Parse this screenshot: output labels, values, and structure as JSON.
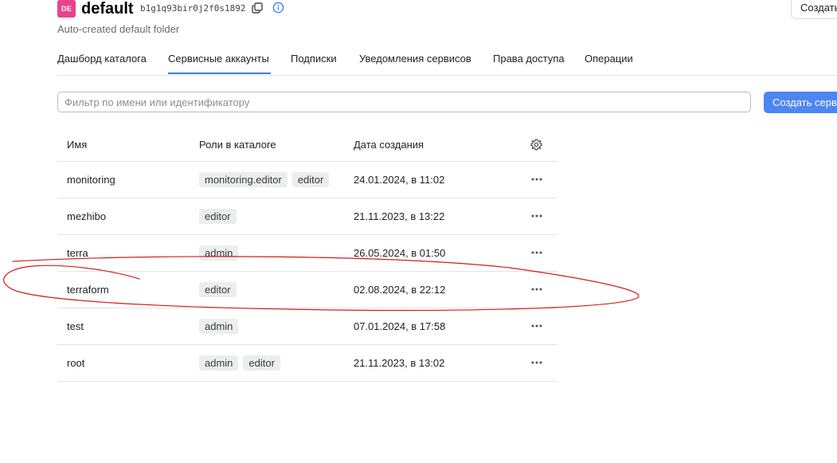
{
  "colors": {
    "accent_pink": "#e8428b",
    "accent_blue": "#3b7be8",
    "annotation_red": "#d21c1c"
  },
  "header": {
    "badge": "DE",
    "folder_name": "default",
    "folder_id": "b1g1q93bir0j2f0s1892",
    "copy_icon": "copy-icon",
    "info_icon": "info-icon",
    "create_button": "Создать",
    "subtitle": "Auto-created default folder"
  },
  "tabs": [
    {
      "label": "Дашборд каталога",
      "active": false
    },
    {
      "label": "Сервисные аккаунты",
      "active": true
    },
    {
      "label": "Подписки",
      "active": false
    },
    {
      "label": "Уведомления сервисов",
      "active": false
    },
    {
      "label": "Права доступа",
      "active": false
    },
    {
      "label": "Операции",
      "active": false
    }
  ],
  "filter": {
    "placeholder": "Фильтр по имени или идентификатору",
    "value": ""
  },
  "create_service_account_button": "Создать серв",
  "table": {
    "columns": [
      "Имя",
      "Роли в каталоге",
      "Дата создания"
    ],
    "settings_icon": "gear-icon",
    "row_menu_icon": "more-horizontal-icon",
    "rows": [
      {
        "name": "monitoring",
        "roles": [
          "monitoring.editor",
          "editor"
        ],
        "created": "24.01.2024, в 11:02"
      },
      {
        "name": "mezhibo",
        "roles": [
          "editor"
        ],
        "created": "21.11.2023, в 13:22"
      },
      {
        "name": "terra",
        "roles": [
          "admin"
        ],
        "created": "26.05.2024, в 01:50"
      },
      {
        "name": "terraform",
        "roles": [
          "editor"
        ],
        "created": "02.08.2024, в 22:12"
      },
      {
        "name": "test",
        "roles": [
          "admin"
        ],
        "created": "07.01.2024, в 17:58"
      },
      {
        "name": "root",
        "roles": [
          "admin",
          "editor"
        ],
        "created": "21.11.2023, в 13:02"
      }
    ]
  },
  "annotation": {
    "type": "hand-drawn-ellipse",
    "highlighted_row": "terraform"
  }
}
